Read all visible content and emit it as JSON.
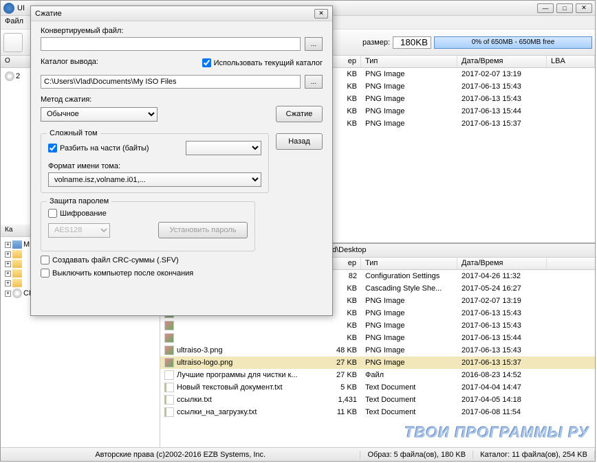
{
  "main": {
    "title": "UI",
    "menu_file": "Файл",
    "size_label": "размер:",
    "size_value": "180KB",
    "progress_text": "0% of 650MB - 650MB free"
  },
  "left": {
    "header_top": "О",
    "header_bot": "Ка",
    "items": [
      {
        "label": "М",
        "kind": "pc"
      },
      {
        "label": "",
        "kind": "folder"
      },
      {
        "label": "",
        "kind": "folder"
      },
      {
        "label": "",
        "kind": "folder"
      },
      {
        "label": "",
        "kind": "folder"
      },
      {
        "label": "CD привод(E:)",
        "kind": "cd"
      }
    ]
  },
  "list_top": {
    "headers": {
      "size": "ер",
      "type": "Тип",
      "date": "Дата/Время",
      "lba": "LBA"
    },
    "rows": [
      {
        "size": "KB",
        "type": "PNG Image",
        "date": "2017-02-07 13:19"
      },
      {
        "size": "KB",
        "type": "PNG Image",
        "date": "2017-06-13 15:43"
      },
      {
        "size": "KB",
        "type": "PNG Image",
        "date": "2017-06-13 15:43"
      },
      {
        "size": "KB",
        "type": "PNG Image",
        "date": "2017-06-13 15:44"
      },
      {
        "size": "KB",
        "type": "PNG Image",
        "date": "2017-06-13 15:37"
      }
    ]
  },
  "list_bot": {
    "path": "d\\Desktop",
    "headers": {
      "size": "ер",
      "type": "Тип",
      "date": "Дата/Время"
    },
    "rows": [
      {
        "name": "",
        "size": "82",
        "type": "Configuration Settings",
        "date": "2017-04-26 11:32",
        "icon": "cfg"
      },
      {
        "name": "",
        "size": "KB",
        "type": "Cascading Style She...",
        "date": "2017-05-24 16:27",
        "icon": "css"
      },
      {
        "name": "",
        "size": "KB",
        "type": "PNG Image",
        "date": "2017-02-07 13:19",
        "icon": "png"
      },
      {
        "name": "",
        "size": "KB",
        "type": "PNG Image",
        "date": "2017-06-13 15:43",
        "icon": "png"
      },
      {
        "name": "",
        "size": "KB",
        "type": "PNG Image",
        "date": "2017-06-13 15:43",
        "icon": "png"
      },
      {
        "name": "",
        "size": "KB",
        "type": "PNG Image",
        "date": "2017-06-13 15:44",
        "icon": "png"
      },
      {
        "name": "ultraiso-3.png",
        "size": "48 KB",
        "type": "PNG Image",
        "date": "2017-06-13 15:43",
        "icon": "png"
      },
      {
        "name": "ultraiso-logo.png",
        "size": "27 KB",
        "type": "PNG Image",
        "date": "2017-06-13 15:37",
        "icon": "png",
        "selected": true
      },
      {
        "name": "Лучшие программы для чистки к...",
        "size": "27 KB",
        "type": "Файл",
        "date": "2016-08-23 14:52",
        "icon": "file"
      },
      {
        "name": "Новый текстовый документ.txt",
        "size": "5 KB",
        "type": "Text Document",
        "date": "2017-04-04 14:47",
        "icon": "txt"
      },
      {
        "name": "ссылки.txt",
        "size": "1,431",
        "type": "Text Document",
        "date": "2017-04-05 14:18",
        "icon": "txt"
      },
      {
        "name": "ссылки_на_загрузку.txt",
        "size": "11 KB",
        "type": "Text Document",
        "date": "2017-06-08 11:54",
        "icon": "txt"
      }
    ]
  },
  "status": {
    "copyright": "Авторские права (c)2002-2016 EZB Systems, Inc.",
    "image": "Образ: 5 файла(ов), 180 KB",
    "catalog": "Каталог: 11 файла(ов), 254 KB"
  },
  "dialog": {
    "title": "Сжатие",
    "lbl_src": "Конвертируемый файл:",
    "lbl_out": "Каталог вывода:",
    "chk_usecur": "Использовать текущий каталог",
    "out_value": "C:\\Users\\Vlad\\Documents\\My ISO Files",
    "lbl_method": "Метод сжатия:",
    "method_value": "Обычное",
    "btn_compress": "Сжатие",
    "grp_vol": "Сложный том",
    "chk_split": "Разбить на части (байты)",
    "lbl_volfmt": "Формат имени тома:",
    "volfmt_value": "volname.isz,volname.i01,...",
    "btn_back": "Назад",
    "grp_pass": "Защита паролем",
    "chk_encrypt": "Шифрование",
    "enc_value": "AES128",
    "btn_setpass": "Установить пароль",
    "chk_crc": "Создавать файл CRC-суммы (.SFV)",
    "chk_shutdown": "Выключить компьютер после окончания"
  },
  "watermark": "ТВОИ ПРОГРАММЫ РУ"
}
